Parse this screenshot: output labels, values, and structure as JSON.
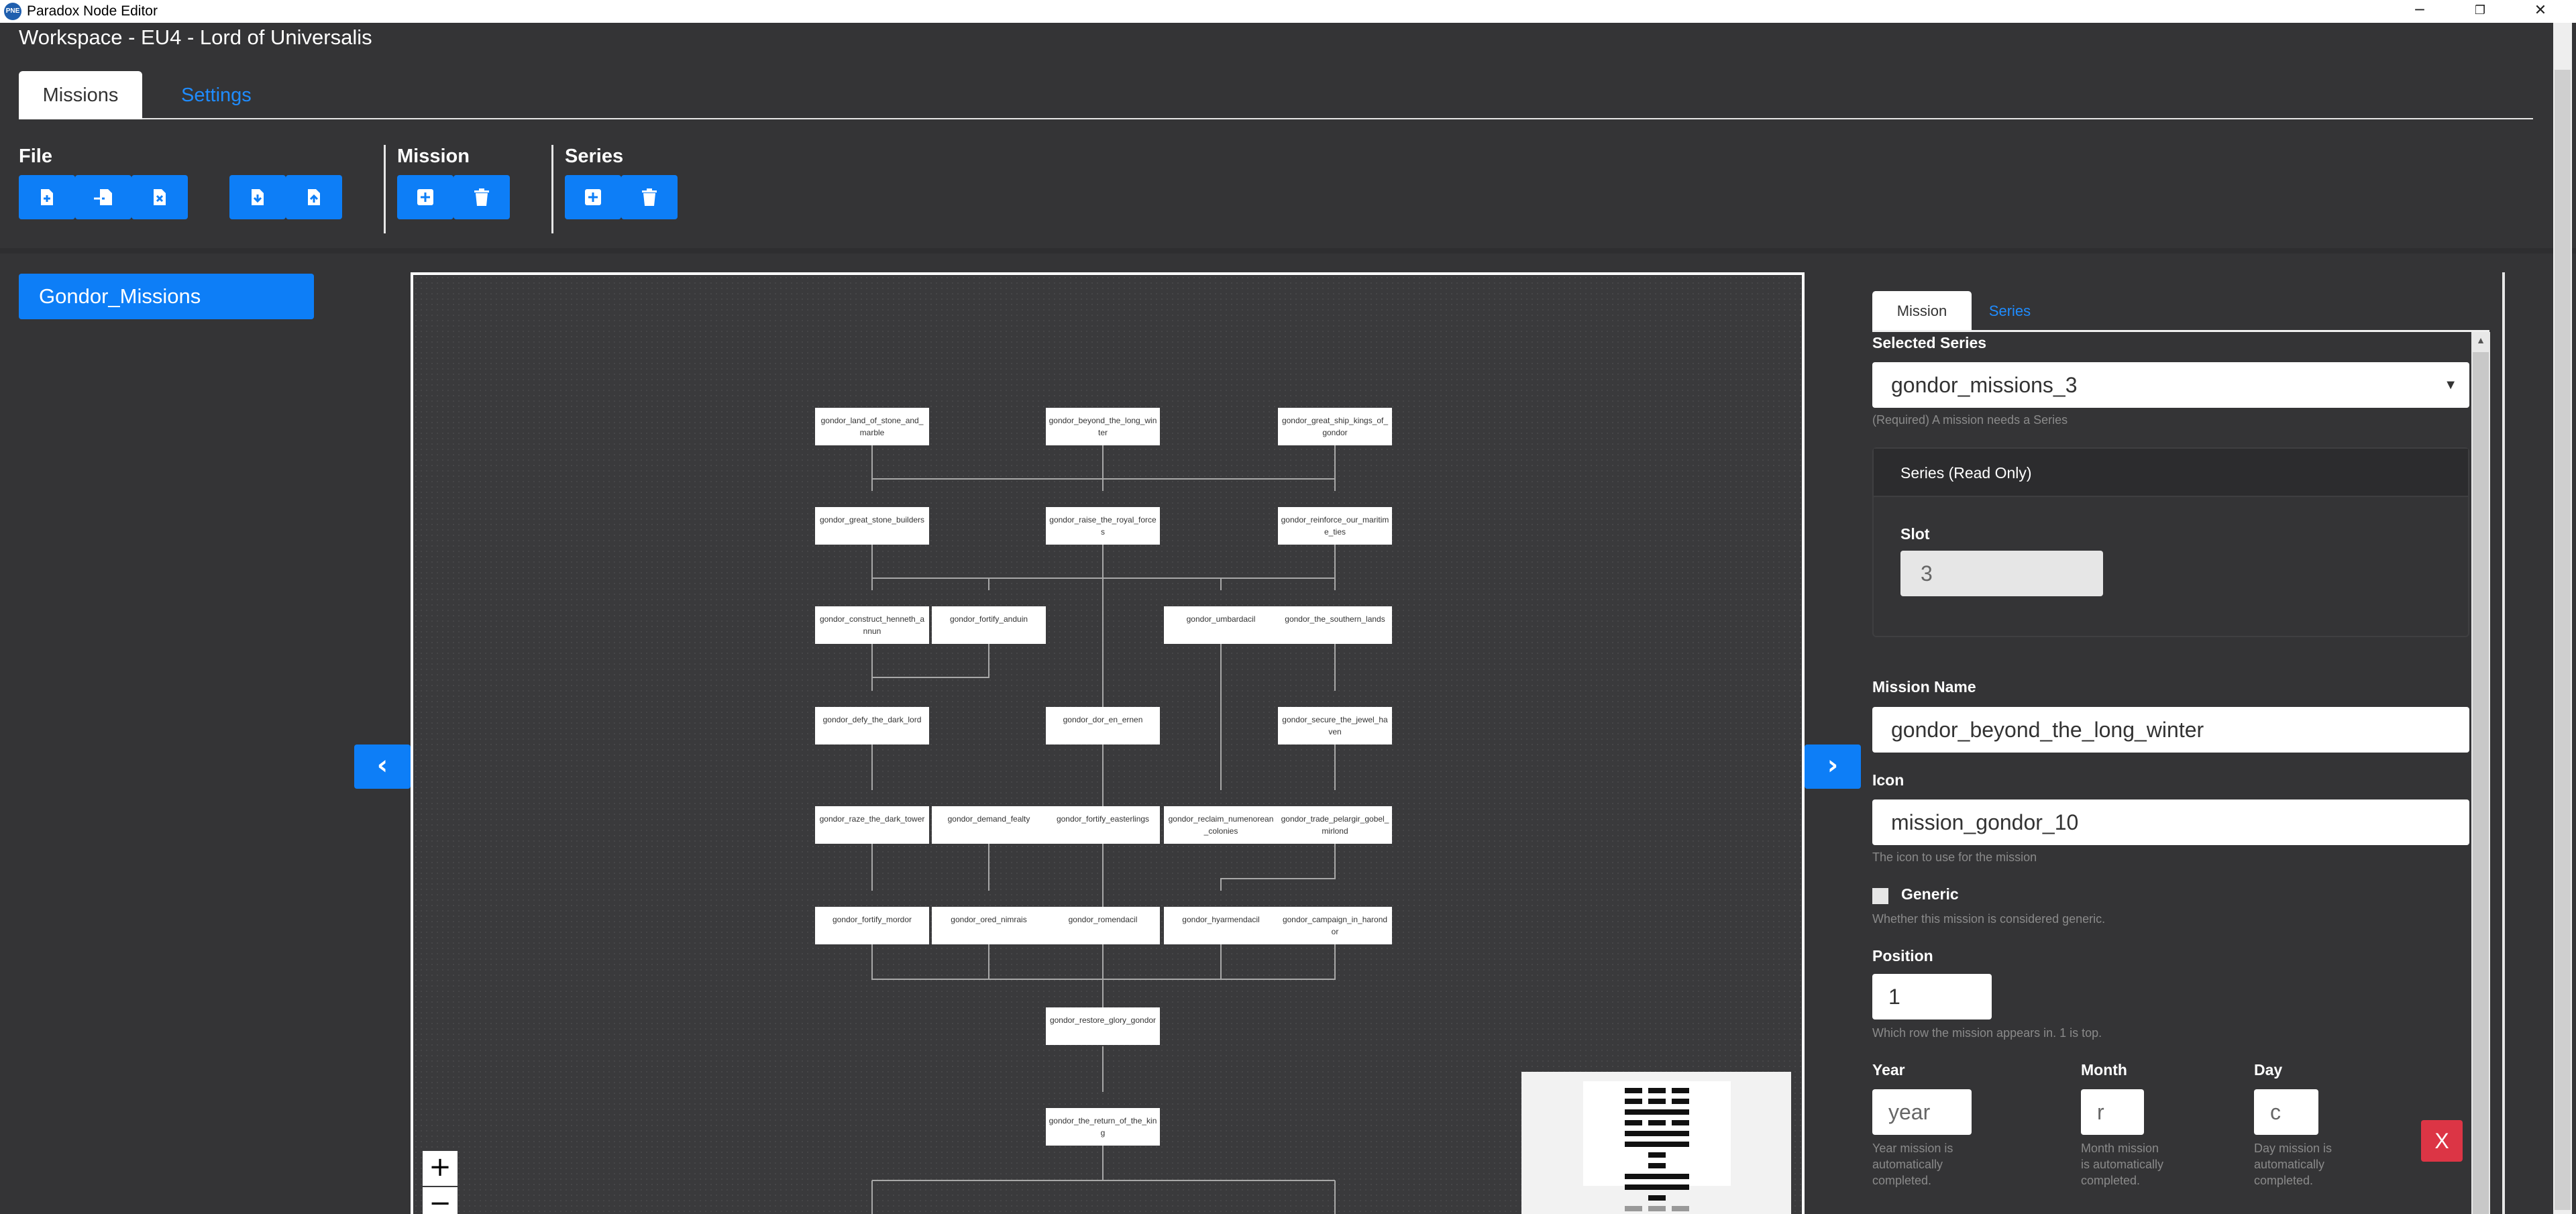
{
  "window": {
    "app_icon_text": "PNE",
    "title": "Paradox Node Editor",
    "minimize": "─",
    "restore": "❐",
    "close": "✕"
  },
  "workspace_title": "Workspace - EU4 - Lord of Universalis",
  "tabs": {
    "missions": "Missions",
    "settings": "Settings"
  },
  "toolbar": {
    "file_label": "File",
    "mission_label": "Mission",
    "series_label": "Series"
  },
  "series_list": [
    "Gondor_Missions"
  ],
  "canvas": {
    "nav_left": "‹",
    "nav_right": "›",
    "zoom_in": "+",
    "zoom_out": "−",
    "nodes": [
      "gondor_land_of_stone_and_marble",
      "gondor_beyond_the_long_winter",
      "gondor_great_ship_kings_of_gondor",
      "gondor_great_stone_builders",
      "gondor_raise_the_royal_forces",
      "gondor_reinforce_our_maritime_ties",
      "gondor_construct_henneth_annun",
      "gondor_fortify_anduin",
      "gondor_umbardacil",
      "gondor_the_southern_lands",
      "gondor_defy_the_dark_lord",
      "gondor_dor_en_ernen",
      "gondor_secure_the_jewel_haven",
      "gondor_raze_the_dark_tower",
      "gondor_demand_fealty",
      "gondor_fortify_easterlings",
      "gondor_reclaim_numenorean_colonies",
      "gondor_trade_pelargir_gobel_mirlond",
      "gondor_fortify_mordor",
      "gondor_ored_nimrais",
      "gondor_romendacil",
      "gondor_hyarmendacil",
      "gondor_campaign_in_harondor",
      "gondor_restore_glory_gondor",
      "gondor_the_return_of_the_king"
    ]
  },
  "panel": {
    "tab_mission": "Mission",
    "tab_series": "Series",
    "selected_series_label": "Selected Series",
    "selected_series_value": "gondor_missions_3",
    "selected_series_help": "(Required) A mission needs a Series",
    "series_card_title": "Series (Read Only)",
    "slot_label": "Slot",
    "slot_value": "3",
    "mission_name_label": "Mission Name",
    "mission_name_value": "gondor_beyond_the_long_winter",
    "icon_label": "Icon",
    "icon_value": "mission_gondor_10",
    "icon_help": "The icon to use for the mission",
    "generic_label": "Generic",
    "generic_help": "Whether this mission is considered generic.",
    "position_label": "Position",
    "position_value": "1",
    "position_help": "Which row the mission appears in. 1 is top.",
    "year_label": "Year",
    "year_placeholder": "year",
    "year_help": "Year mission is automatically completed.",
    "month_label": "Month",
    "month_placeholder": "r",
    "month_help": "Month mission is automatically completed.",
    "day_label": "Day",
    "day_placeholder": "c",
    "day_help": "Day mission is automatically completed.",
    "close_label": "X"
  }
}
